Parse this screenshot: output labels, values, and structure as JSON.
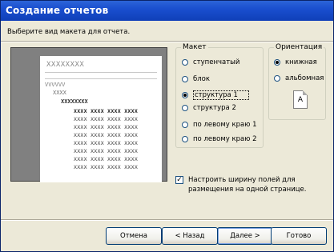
{
  "window": {
    "title": "Создание отчетов"
  },
  "header": {
    "subtitle": "Выберите вид макета для отчета."
  },
  "preview": {
    "title": "XXXXXXXX",
    "level1": "VVVVVV",
    "level2": "XXXX",
    "level3": "XXXXXXXX",
    "rows": [
      "XXXX XXXX XXXX XXXX",
      "XXXX XXXX XXXX XXXX",
      "XXXX XXXX XXXX XXXX",
      "XXXX XXXX XXXX XXXX",
      "XXXX XXXX XXXX XXXX",
      "XXXX XXXX XXXX XXXX",
      "XXXX XXXX XXXX XXXX",
      "XXXX XXXX XXXX XXXX"
    ]
  },
  "layout": {
    "legend": "Макет",
    "options": [
      "ступенчатый",
      "блок",
      "структура 1",
      "структура 2",
      "по левому краю 1",
      "по левому краю 2"
    ],
    "selected": "структура 1"
  },
  "orientation": {
    "legend": "Ориентация",
    "options": [
      "книжная",
      "альбомная"
    ],
    "selected": "книжная",
    "icon_letter": "A"
  },
  "fit_width": {
    "checked": true,
    "label_line1": "Настроить ширину полей для",
    "label_line2": "размещения на одной странице."
  },
  "buttons": {
    "cancel": "Отмена",
    "back": "< Назад",
    "next": "Далее >",
    "finish": "Готово"
  }
}
